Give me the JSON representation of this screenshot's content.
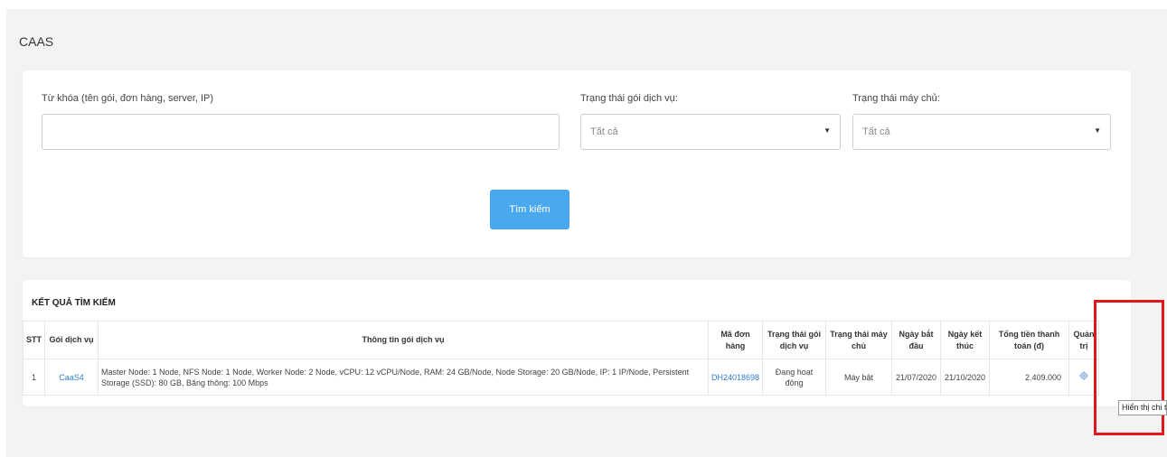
{
  "page": {
    "title": "CAAS"
  },
  "search": {
    "keyword_label": "Từ khóa (tên gói, đơn hàng, server, IP)",
    "keyword_value": "",
    "package_status_label": "Trạng thái gói dịch vụ:",
    "package_status_value": "Tất cả",
    "server_status_label": "Trạng thái máy chủ:",
    "server_status_value": "Tất cả",
    "search_button": "Tìm kiếm"
  },
  "results": {
    "title": "KẾT QUẢ TÌM KIẾM",
    "columns": [
      "STT",
      "Gói dịch vụ",
      "Thông tin gói dịch vụ",
      "Mã đơn hàng",
      "Trạng thái gói dịch vụ",
      "Trạng thái máy chủ",
      "Ngày bắt đầu",
      "Ngày kết thúc",
      "Tổng tiền thanh toán (đ)",
      "Quản trị"
    ],
    "rows": [
      {
        "stt": "1",
        "package": "CaaS4",
        "info": "Master Node: 1 Node, NFS Node: 1 Node, Worker Node: 2 Node, vCPU: 12 vCPU/Node, RAM: 24 GB/Node, Node Storage: 20 GB/Node, IP: 1 IP/Node, Persistent Storage (SSD): 80 GB, Băng thông: 100 Mbps",
        "order_code": "DH24018698",
        "package_status": "Đang hoạt động",
        "server_status": "Máy bật",
        "start_date": "21/07/2020",
        "end_date": "21/10/2020",
        "total": "2.409.000",
        "manage_icon": "gear-icon"
      }
    ]
  },
  "tooltip": {
    "text": "Hiển thị chi tiết"
  },
  "colors": {
    "accent": "#4aa8f0",
    "link": "#2f7fd4",
    "highlight": "#e0181b"
  }
}
